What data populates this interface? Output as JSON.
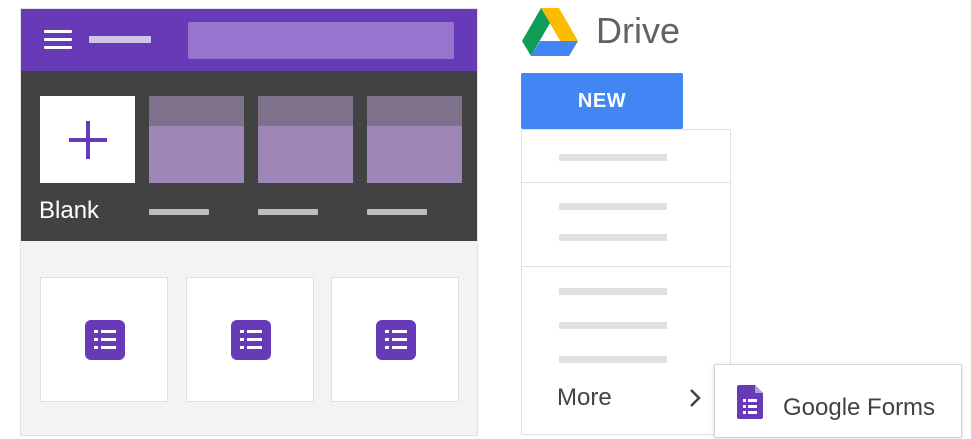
{
  "forms": {
    "blank_label": "Blank",
    "recent_forms_count": 3
  },
  "drive": {
    "title": "Drive",
    "new_button": "NEW",
    "menu": {
      "more_label": "More",
      "submenu_item": "Google Forms"
    }
  },
  "icons": {
    "menu": "hamburger-icon",
    "add": "plus-icon",
    "forms_doc": "form-doc-icon",
    "drive_logo": "google-drive-logo",
    "chevron": "chevron-right-icon",
    "google_forms": "google-forms-icon"
  },
  "colors": {
    "forms_purple": "#673ab7",
    "gallery_bg": "#424242",
    "drive_blue": "#4285f4"
  }
}
